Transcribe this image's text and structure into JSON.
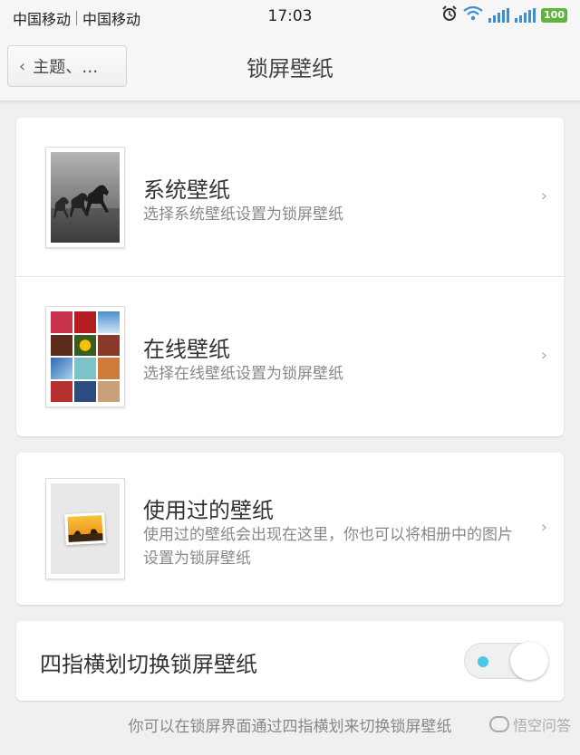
{
  "status_bar": {
    "carrier1": "中国移动",
    "carrier2": "中国移动",
    "time": "17:03",
    "battery": "100",
    "signal_color": "#3c8fd6",
    "battery_color": "#5fb53a"
  },
  "header": {
    "back_label": "主题、…",
    "title": "锁屏壁纸"
  },
  "wallpaper_sources": [
    {
      "title": "系统壁纸",
      "subtitle": "选择系统壁纸设置为锁屏壁纸",
      "icon": "horses-photo-thumbnail"
    },
    {
      "title": "在线壁纸",
      "subtitle": "选择在线壁纸设置为锁屏壁纸",
      "icon": "photo-collage-thumbnail"
    }
  ],
  "used_wallpaper": {
    "title": "使用过的壁纸",
    "subtitle": "使用过的壁纸会出现在这里，你也可以将相册中的图片设置为锁屏壁纸",
    "icon": "sunset-photo-icon"
  },
  "four_finger_swipe": {
    "label": "四指横划切换锁屏壁纸",
    "enabled": false,
    "hint": "你可以在锁屏界面通过四指横划来切换锁屏壁纸"
  },
  "watermark": "悟空问答",
  "chevron": "›"
}
